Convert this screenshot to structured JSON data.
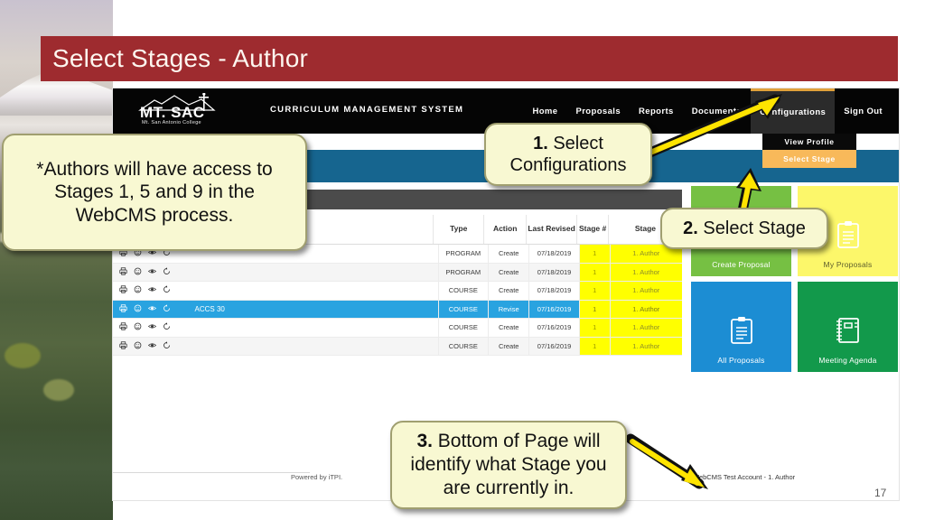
{
  "slide": {
    "title": "Select Stages - Author",
    "page_number": "17",
    "title_bar_color": "#9e2b2f"
  },
  "callouts": {
    "note": "*Authors will have access to Stages 1, 5 and 9 in the WebCMS process.",
    "step1_num": "1.",
    "step1_text": " Select Configurations",
    "step2_num": "2.",
    "step2_text": " Select Stage",
    "step3_num": "3.",
    "step3_text": " Bottom of Page will identify what Stage you are currently in."
  },
  "app": {
    "logo_word": "MT. SAC",
    "logo_sub": "Mt. San Antonio College",
    "system_title": "CURRICULUM MANAGEMENT SYSTEM",
    "nav": [
      {
        "label": "Home",
        "active": false
      },
      {
        "label": "Proposals",
        "active": false
      },
      {
        "label": "Reports",
        "active": false
      },
      {
        "label": "Documents",
        "active": false
      },
      {
        "label": "Configurations",
        "active": true
      },
      {
        "label": "Sign Out",
        "active": false
      }
    ],
    "dropdown": {
      "items": [
        "View Profile"
      ],
      "selected": "Select Stage",
      "selected_color": "#f8b95a"
    },
    "table": {
      "headers": [
        "",
        "",
        "Type",
        "Action",
        "Last Revised",
        "Stage #",
        "Stage"
      ],
      "rows": [
        {
          "name": "",
          "type": "PROGRAM",
          "action": "Create",
          "revised": "07/18/2019",
          "stage_num": "1",
          "stage": "1. Author",
          "selected": false,
          "alt": false
        },
        {
          "name": "",
          "type": "PROGRAM",
          "action": "Create",
          "revised": "07/18/2019",
          "stage_num": "1",
          "stage": "1. Author",
          "selected": false,
          "alt": true
        },
        {
          "name": "",
          "type": "COURSE",
          "action": "Create",
          "revised": "07/18/2019",
          "stage_num": "1",
          "stage": "1. Author",
          "selected": false,
          "alt": false
        },
        {
          "name": "ACCS 30",
          "type": "COURSE",
          "action": "Revise",
          "revised": "07/16/2019",
          "stage_num": "1",
          "stage": "1. Author",
          "selected": true,
          "alt": false
        },
        {
          "name": "",
          "type": "COURSE",
          "action": "Create",
          "revised": "07/16/2019",
          "stage_num": "1",
          "stage": "1. Author",
          "selected": false,
          "alt": false
        },
        {
          "name": "",
          "type": "COURSE",
          "action": "Create",
          "revised": "07/16/2019",
          "stage_num": "1",
          "stage": "1. Author",
          "selected": false,
          "alt": true
        }
      ],
      "row_icons": [
        "print-icon",
        "comment-icon",
        "eye-icon",
        "history-icon"
      ],
      "stage_highlight_color": "#ffff00",
      "selected_row_color": "#29a3e0"
    },
    "tiles": [
      {
        "label": "Create Proposal",
        "color": "#76c043",
        "icon": "clipboard-icon"
      },
      {
        "label": "My Proposals",
        "color": "#fcf76a",
        "icon": "clipboard-icon"
      },
      {
        "label": "All Proposals",
        "color": "#1c8dd3",
        "icon": "clipboard-icon"
      },
      {
        "label": "Meeting Agenda",
        "color": "#12994b",
        "icon": "notebook-icon"
      }
    ],
    "footer": {
      "powered_by": "Powered by iTPI.",
      "account": "WebCMS Test Account  -  1. Author"
    }
  }
}
